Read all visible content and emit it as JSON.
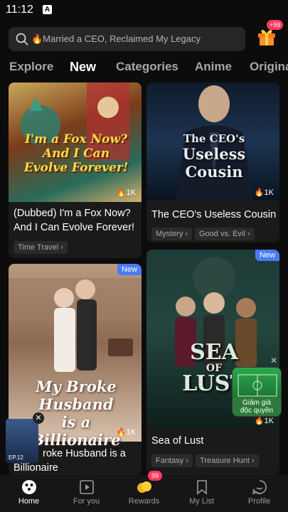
{
  "status_bar": {
    "time": "11:12",
    "notification_icon": "A"
  },
  "search": {
    "placeholder": "🔥Married a CEO, Reclaimed My Legacy"
  },
  "gift": {
    "badge": "+99"
  },
  "tabs": [
    {
      "label": "Explore",
      "active": false
    },
    {
      "label": "New",
      "active": true
    },
    {
      "label": "Categories",
      "active": false
    },
    {
      "label": "Anime",
      "active": false
    },
    {
      "label": "Origina",
      "active": false
    }
  ],
  "cards": [
    {
      "poster_text": [
        "I'm a Fox Now?",
        "And I Can",
        "Evolve Forever!"
      ],
      "count": "1K",
      "title": "(Dubbed) I'm a Fox Now? And I Can Evolve Forever!",
      "tags": [
        "Time Travel ›"
      ]
    },
    {
      "poster_text": [
        "The CEO's",
        "Useless Cousin"
      ],
      "count": "1K",
      "title": "The CEO's Useless Cousin",
      "tags": [
        "Mystery ›",
        "Good vs. Evil ›"
      ]
    },
    {
      "badge": "New",
      "poster_text": [
        "My Broke Husband",
        "is a Billionaire"
      ],
      "count": "1K",
      "title": "My Broke Husband is a Billionaire",
      "title_visible": "roke Husband is a",
      "title_line2": "Billionaire"
    },
    {
      "badge": "New",
      "poster_text": [
        "SEA",
        "OF",
        "LUST"
      ],
      "count": "1K",
      "title": "Sea of Lust",
      "tags": [
        "Fantasy ›",
        "Treasure Hunt ›"
      ]
    }
  ],
  "mini_player": {
    "episode": "EP.12"
  },
  "promo": {
    "label_line1": "Giảm giá",
    "label_line2": "độc quyền"
  },
  "bottom_nav": [
    {
      "label": "Home",
      "icon": "home-icon",
      "active": true
    },
    {
      "label": "For you",
      "icon": "play-icon",
      "active": false
    },
    {
      "label": "Rewards",
      "icon": "coins-icon",
      "active": false,
      "badge": "99"
    },
    {
      "label": "My List",
      "icon": "bookmark-icon",
      "active": false
    },
    {
      "label": "Profile",
      "icon": "profile-icon",
      "active": false
    }
  ],
  "colors": {
    "accent_new": "#4a7bf7",
    "badge_red": "#ff3b5c",
    "background": "#0c0c0c"
  }
}
